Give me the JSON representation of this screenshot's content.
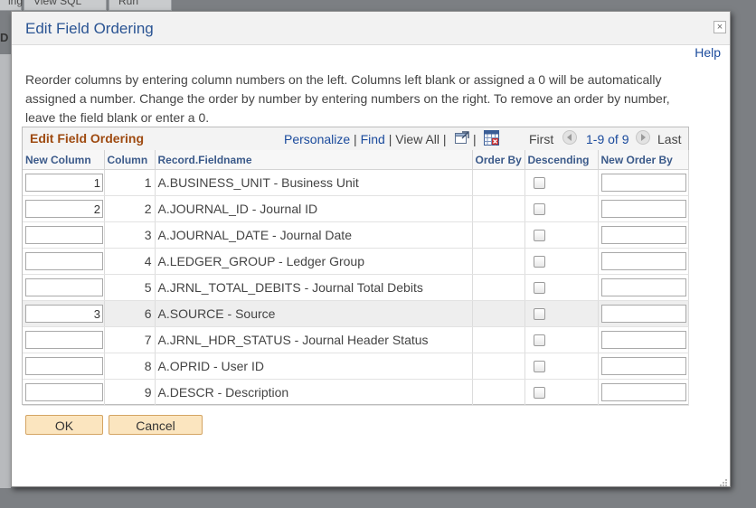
{
  "background": {
    "tabs": [
      "ing",
      "View SQL",
      "Run"
    ],
    "left_letter": "D"
  },
  "dialog": {
    "title": "Edit Field Ordering",
    "close_glyph": "×",
    "help_label": "Help",
    "instructions": "Reorder columns by entering column numbers on the left. Columns left blank or assigned a 0 will be automatically assigned a number. Change the order by number by entering numbers on the right. To remove an order by number, leave the field blank or enter a 0."
  },
  "grid": {
    "title": "Edit Field Ordering",
    "personalize": "Personalize",
    "find": "Find",
    "view_all": "View All",
    "separator": "|",
    "first": "First",
    "range": "1-9 of 9",
    "last": "Last",
    "columns": {
      "new_column": "New Column",
      "column": "Column",
      "record_fieldname": "Record.Fieldname",
      "order_by": "Order By",
      "descending": "Descending",
      "new_order_by": "New Order By"
    },
    "rows": [
      {
        "new_column": "1",
        "column": "1",
        "field": "A.BUSINESS_UNIT - Business Unit",
        "order_by": "",
        "descending": false,
        "new_order_by": ""
      },
      {
        "new_column": "2",
        "column": "2",
        "field": "A.JOURNAL_ID - Journal ID",
        "order_by": "",
        "descending": false,
        "new_order_by": ""
      },
      {
        "new_column": "",
        "column": "3",
        "field": "A.JOURNAL_DATE - Journal Date",
        "order_by": "",
        "descending": false,
        "new_order_by": ""
      },
      {
        "new_column": "",
        "column": "4",
        "field": "A.LEDGER_GROUP - Ledger Group",
        "order_by": "",
        "descending": false,
        "new_order_by": ""
      },
      {
        "new_column": "",
        "column": "5",
        "field": "A.JRNL_TOTAL_DEBITS - Journal Total Debits",
        "order_by": "",
        "descending": false,
        "new_order_by": ""
      },
      {
        "new_column": "3",
        "column": "6",
        "field": "A.SOURCE - Source",
        "order_by": "",
        "descending": false,
        "new_order_by": ""
      },
      {
        "new_column": "",
        "column": "7",
        "field": "A.JRNL_HDR_STATUS - Journal Header Status",
        "order_by": "",
        "descending": false,
        "new_order_by": ""
      },
      {
        "new_column": "",
        "column": "8",
        "field": "A.OPRID - User ID",
        "order_by": "",
        "descending": false,
        "new_order_by": ""
      },
      {
        "new_column": "",
        "column": "9",
        "field": "A.DESCR - Description",
        "order_by": "",
        "descending": false,
        "new_order_by": ""
      }
    ],
    "highlighted_row": 5
  },
  "buttons": {
    "ok": "OK",
    "cancel": "Cancel"
  },
  "colors": {
    "title_blue": "#2a5493",
    "grid_title_brown": "#9e4a10",
    "button_fill": "#fbe5bf",
    "button_border": "#d4a463"
  },
  "icons": [
    "close-icon",
    "zoom-grid-icon",
    "download-excel-icon",
    "first-arrow-icon",
    "last-arrow-icon",
    "resize-grip-icon"
  ]
}
